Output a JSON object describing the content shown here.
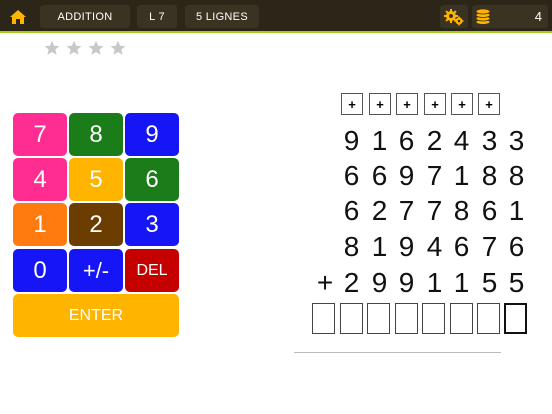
{
  "topbar": {
    "mode_label": "ADDITION",
    "level_label": "L 7",
    "lines_label": "5 LIGNES",
    "coins": "4"
  },
  "stars": {
    "earned": 0,
    "total": 4
  },
  "keypad": {
    "rows": [
      [
        {
          "label": "7",
          "color": "#ff2d91"
        },
        {
          "label": "8",
          "color": "#1a7d1a"
        },
        {
          "label": "9",
          "color": "#1515f5"
        }
      ],
      [
        {
          "label": "4",
          "color": "#ff2d91"
        },
        {
          "label": "5",
          "color": "#ffb400"
        },
        {
          "label": "6",
          "color": "#1a7d1a"
        }
      ],
      [
        {
          "label": "1",
          "color": "#ff7b10"
        },
        {
          "label": "2",
          "color": "#6b3d00"
        },
        {
          "label": "3",
          "color": "#1515f5"
        }
      ],
      [
        {
          "label": "0",
          "color": "#1515f5"
        },
        {
          "label": "+/-",
          "color": "#1515f5"
        },
        {
          "label": "DEL",
          "color": "#c40000"
        }
      ]
    ],
    "enter": {
      "label": "ENTER",
      "color": "#ffb400"
    }
  },
  "problem": {
    "operators": [
      "+",
      "+",
      "+",
      "+",
      "+",
      "+"
    ],
    "rows": [
      [
        "9",
        "1",
        "6",
        "2",
        "4",
        "3",
        "3"
      ],
      [
        "6",
        "6",
        "9",
        "7",
        "1",
        "8",
        "8"
      ],
      [
        "6",
        "2",
        "7",
        "7",
        "8",
        "6",
        "1"
      ],
      [
        "8",
        "1",
        "9",
        "4",
        "6",
        "7",
        "6"
      ],
      [
        "2",
        "9",
        "9",
        "1",
        "1",
        "5",
        "5"
      ]
    ],
    "plus_sign": "+",
    "answer_slots": 8
  }
}
